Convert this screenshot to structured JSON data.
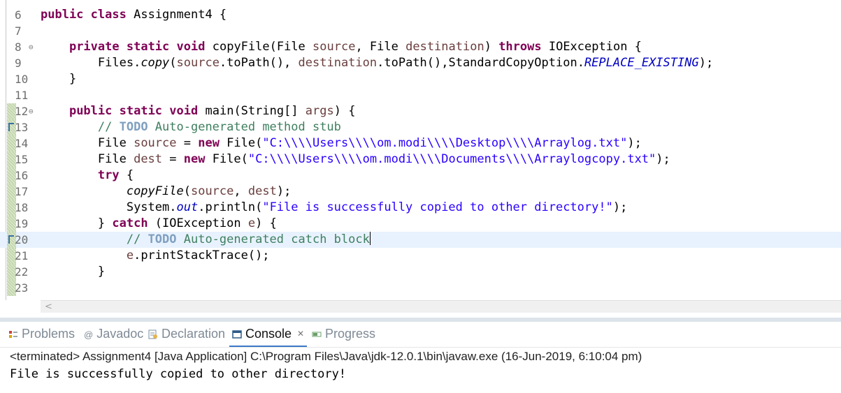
{
  "editor": {
    "lines": {
      "l6": {
        "num": "6",
        "tokens": [
          "public",
          "class",
          "Assignment4 {"
        ]
      },
      "l7": {
        "num": "7"
      },
      "l8": {
        "num": "8",
        "tokens": [
          "private",
          "static",
          "void",
          "copyFile(File ",
          "source",
          ", File ",
          "destination",
          ") ",
          "throws",
          " IOException {"
        ]
      },
      "l9": {
        "num": "9",
        "tokens": [
          "Files.",
          "copy",
          "(",
          "source",
          ".toPath(), ",
          "destination",
          ".toPath(),StandardCopyOption.",
          "REPLACE_EXISTING",
          ");"
        ]
      },
      "l10": {
        "num": "10",
        "tokens": [
          "}"
        ]
      },
      "l11": {
        "num": "11"
      },
      "l12": {
        "num": "12",
        "tokens": [
          "public",
          "static",
          "void",
          "main(String[] ",
          "args",
          ") {"
        ]
      },
      "l13": {
        "num": "13",
        "tokens": [
          "// ",
          "TODO",
          " Auto-generated method stub"
        ]
      },
      "l14": {
        "num": "14",
        "tokens": [
          "File ",
          "source",
          " = ",
          "new",
          " File(",
          "\"C:\\\\\\\\Users\\\\\\\\om.modi\\\\\\\\Desktop\\\\\\\\Arraylog.txt\"",
          ");"
        ]
      },
      "l15": {
        "num": "15",
        "tokens": [
          "File ",
          "dest",
          " = ",
          "new",
          " File(",
          "\"C:\\\\\\\\Users\\\\\\\\om.modi\\\\\\\\Documents\\\\\\\\Arraylogcopy.txt\"",
          ");"
        ]
      },
      "l16": {
        "num": "16",
        "tokens": [
          "try",
          " {"
        ]
      },
      "l17": {
        "num": "17",
        "tokens": [
          "copyFile",
          "(",
          "source",
          ", ",
          "dest",
          ");"
        ]
      },
      "l18": {
        "num": "18",
        "tokens": [
          "System.",
          "out",
          ".println(",
          "\"File is successfully copied to other directory!\"",
          ");"
        ]
      },
      "l19": {
        "num": "19",
        "tokens": [
          "} ",
          "catch",
          " (IOException ",
          "e",
          ") {"
        ]
      },
      "l20": {
        "num": "20",
        "tokens": [
          "// ",
          "TODO",
          " Auto-generated catch block"
        ]
      },
      "l21": {
        "num": "21",
        "tokens": [
          "e",
          ".printStackTrace();"
        ]
      },
      "l22": {
        "num": "22",
        "tokens": [
          "}"
        ]
      },
      "l23": {
        "num": "23"
      }
    },
    "fold_glyph": "⊖",
    "scroll_left_arrow": "<"
  },
  "panel": {
    "tabs": {
      "problems": "Problems",
      "javadoc": "Javadoc",
      "declaration": "Declaration",
      "console": "Console",
      "console_close": "✕",
      "progress": "Progress"
    },
    "javadoc_icon_glyph": "@",
    "console_header": "<terminated> Assignment4 [Java Application] C:\\Program Files\\Java\\jdk-12.0.1\\bin\\javaw.exe (16-Jun-2019, 6:10:04 pm)",
    "console_output": "File is successfully copied to other directory!"
  },
  "colors": {
    "keyword": "#7f0055",
    "string": "#2a00ff",
    "comment": "#3f7f5f",
    "field": "#0000c0",
    "local_variable": "#6a3e3e",
    "current_line": "#e8f2fe"
  }
}
